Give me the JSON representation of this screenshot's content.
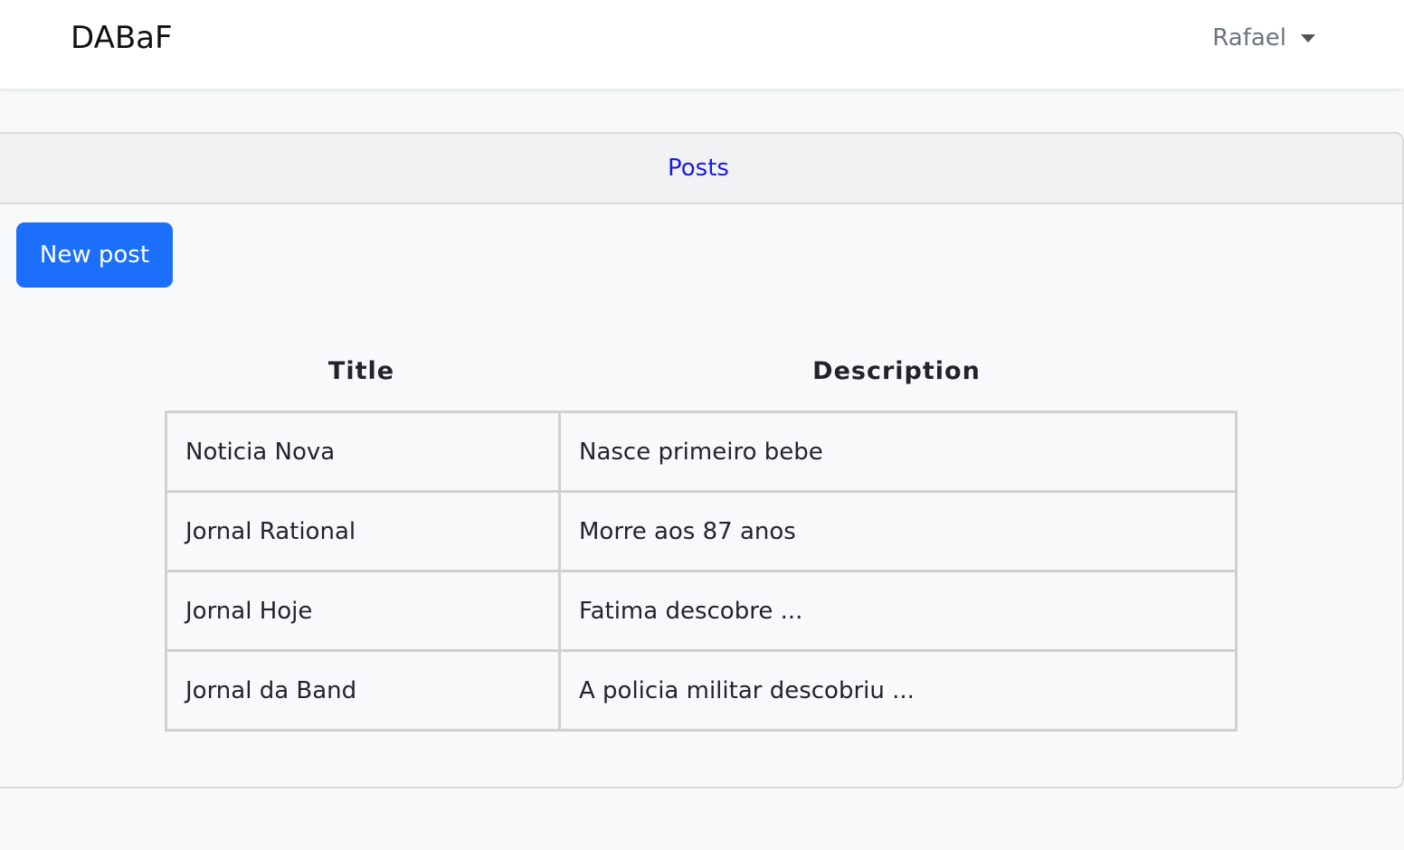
{
  "navbar": {
    "brand": "DABaF",
    "user": "Rafael"
  },
  "card": {
    "header_link": "Posts",
    "new_post_label": "New post"
  },
  "table": {
    "headers": [
      "Title",
      "Description"
    ],
    "rows": [
      {
        "title": "Noticia Nova",
        "description": "Nasce primeiro bebe"
      },
      {
        "title": "Jornal Rational",
        "description": "Morre aos 87 anos"
      },
      {
        "title": "Jornal Hoje",
        "description": "Fatima descobre ..."
      },
      {
        "title": "Jornal da Band",
        "description": "A policia militar descobriu ..."
      }
    ]
  },
  "colors": {
    "primary_button": "#1b6ffa",
    "link": "#1a1ae6",
    "background": "#f8f9fa"
  }
}
